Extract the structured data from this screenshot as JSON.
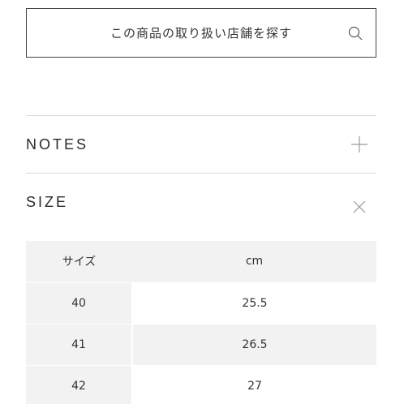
{
  "store_search": {
    "label": "この商品の取り扱い店舗を探す",
    "icon": "search-icon"
  },
  "sections": {
    "notes": {
      "title": "NOTES",
      "icon": "plus-icon",
      "expanded": false
    },
    "size": {
      "title": "SIZE",
      "icon": "close-icon",
      "expanded": true
    }
  },
  "size_table": {
    "headers": [
      "サイズ",
      "cm"
    ],
    "rows": [
      [
        "40",
        "25.5"
      ],
      [
        "41",
        "26.5"
      ],
      [
        "42",
        "27"
      ]
    ]
  },
  "colors": {
    "border": "#444444",
    "divider": "#dcdcdc",
    "table_shade": "#f2f2f2"
  }
}
